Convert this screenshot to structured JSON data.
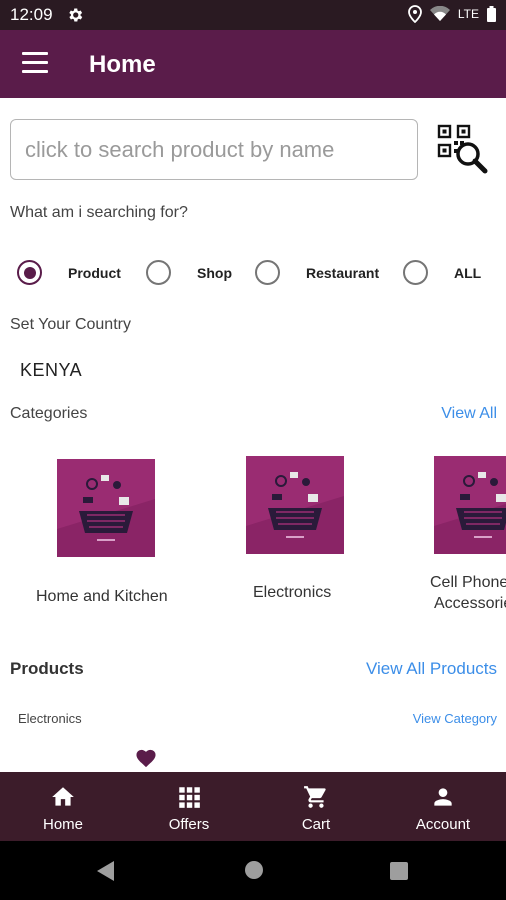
{
  "status_bar": {
    "time": "12:09",
    "network": "LTE"
  },
  "app_bar": {
    "title": "Home"
  },
  "search": {
    "placeholder": "click to search product by name",
    "value": ""
  },
  "search_type": {
    "prompt": "What am i searching for?",
    "options": [
      "Product",
      "Shop",
      "Restaurant",
      "ALL"
    ],
    "selected": "Product"
  },
  "country": {
    "label": "Set Your Country",
    "value": "KENYA"
  },
  "categories": {
    "label": "Categories",
    "view_all": "View All",
    "items": [
      {
        "name": "Home and Kitchen"
      },
      {
        "name": "Electronics"
      },
      {
        "name_line1": "Cell Phone",
        "name_line2": "Accessories"
      }
    ]
  },
  "products": {
    "label": "Products",
    "view_all": "View All Products",
    "section": "Electronics",
    "view_category": "View Category"
  },
  "bottom_nav": {
    "items": [
      {
        "label": "Home",
        "icon": "home-icon"
      },
      {
        "label": "Offers",
        "icon": "grid-icon"
      },
      {
        "label": "Cart",
        "icon": "cart-icon"
      },
      {
        "label": "Account",
        "icon": "person-icon"
      }
    ]
  },
  "colors": {
    "primary": "#5a1c4a",
    "nav": "#3c1c2a",
    "link": "#3c8ee8",
    "category_bg": "#9a2c72"
  }
}
